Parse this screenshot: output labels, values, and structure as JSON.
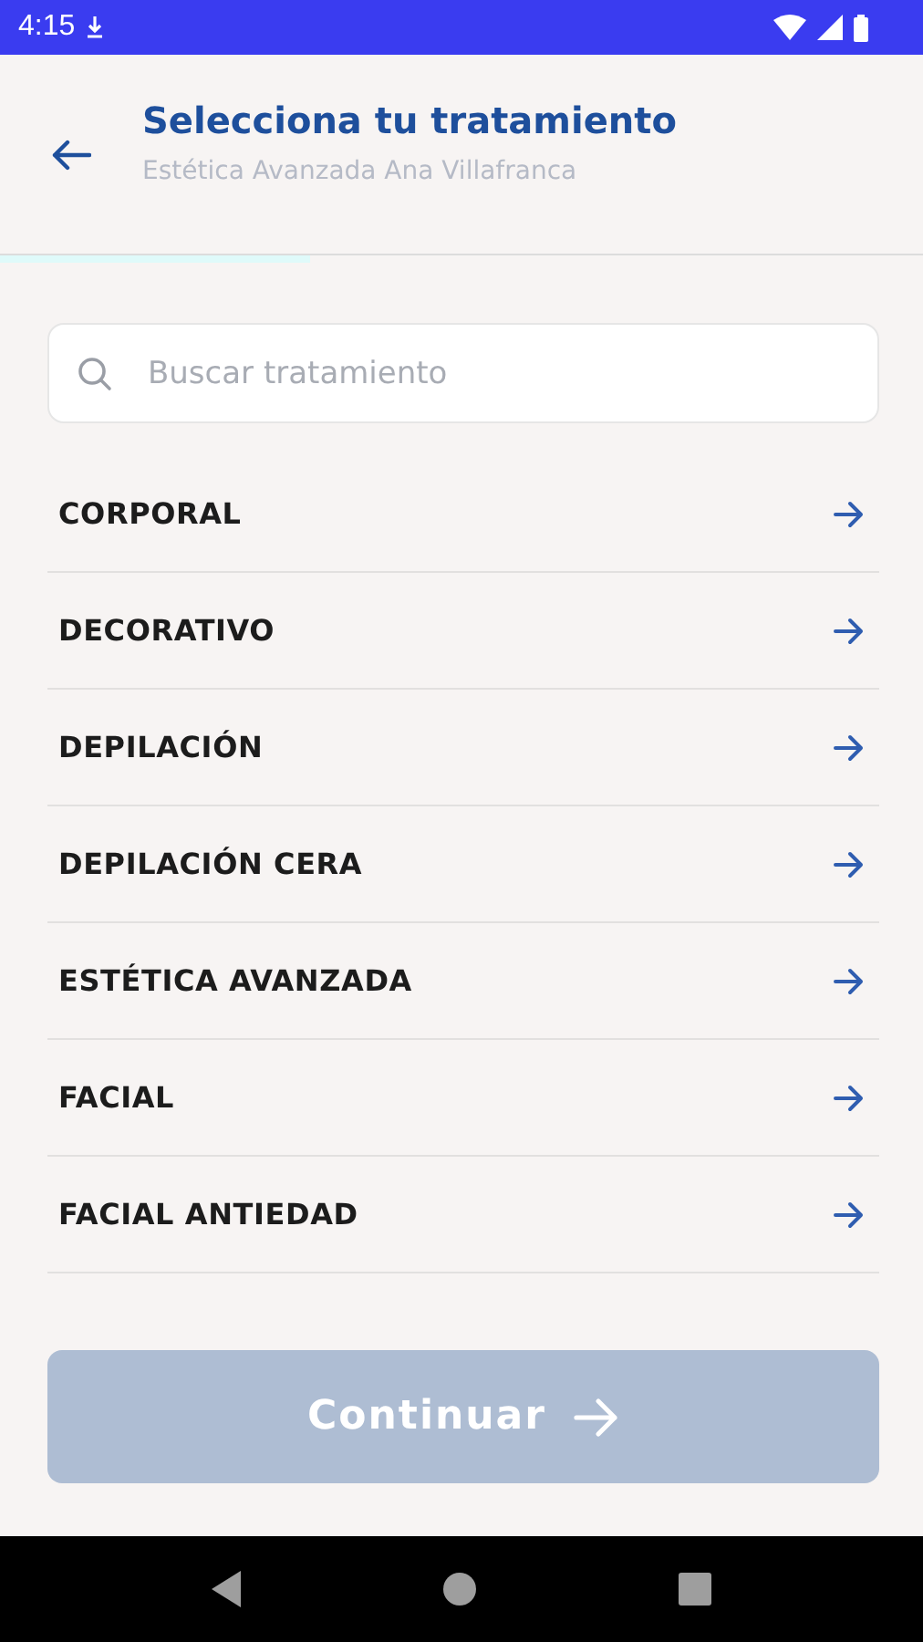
{
  "status_bar": {
    "time": "4:15"
  },
  "header": {
    "title": "Selecciona tu tratamiento",
    "subtitle": "Estética Avanzada Ana Villafranca"
  },
  "progress": {
    "level": 0.335
  },
  "search": {
    "placeholder": "Buscar tratamiento"
  },
  "categories": [
    {
      "label": "CORPORAL"
    },
    {
      "label": "DECORATIVO"
    },
    {
      "label": "DEPILACIÓN"
    },
    {
      "label": "DEPILACIÓN CERA"
    },
    {
      "label": "ESTÉTICA AVANZADA"
    },
    {
      "label": "FACIAL"
    },
    {
      "label": "FACIAL ANTIEDAD"
    }
  ],
  "continue_button": {
    "label": "Continuar",
    "disabled": true
  }
}
